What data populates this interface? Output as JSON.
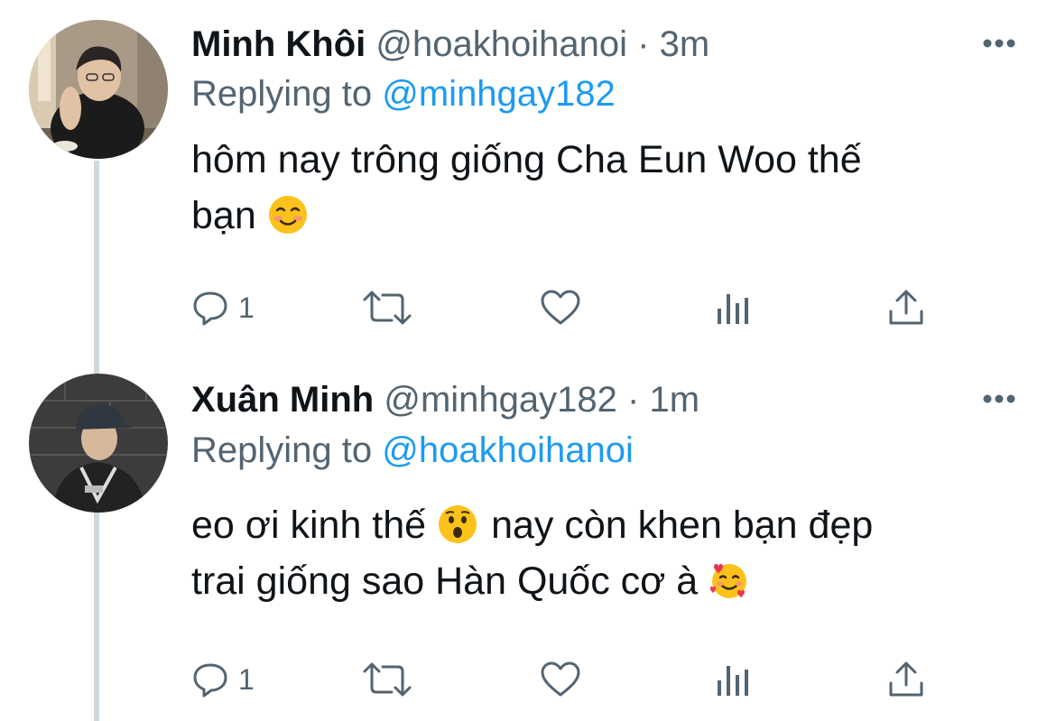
{
  "tweets": [
    {
      "name": "Minh Khôi",
      "handle": "@hoakhoihanoi",
      "separator": "·",
      "time": "3m",
      "replying_prefix": "Replying to",
      "replying_to": "@minhgay182",
      "text_line1": "hôm nay trông giống Cha Eun Woo thế",
      "text_line2": "bạn",
      "reply_count": "1",
      "emoji_1": "smiling-face-emoji"
    },
    {
      "name": "Xuân Minh",
      "handle": "@minhgay182",
      "separator": "·",
      "time": "1m",
      "replying_prefix": "Replying to",
      "replying_to": "@hoakhoihanoi",
      "text_line1a": "eo ơi kinh thế",
      "text_line1b": "nay còn khen bạn đẹp",
      "text_line2": "trai giống sao Hàn Quốc cơ à",
      "reply_count": "1",
      "emoji_1": "hushed-face-emoji",
      "emoji_2": "smiling-face-with-hearts-emoji"
    }
  ],
  "colors": {
    "text": "#0f1419",
    "muted": "#536471",
    "link": "#1d9bf0",
    "thread_line": "#cfd9de"
  }
}
